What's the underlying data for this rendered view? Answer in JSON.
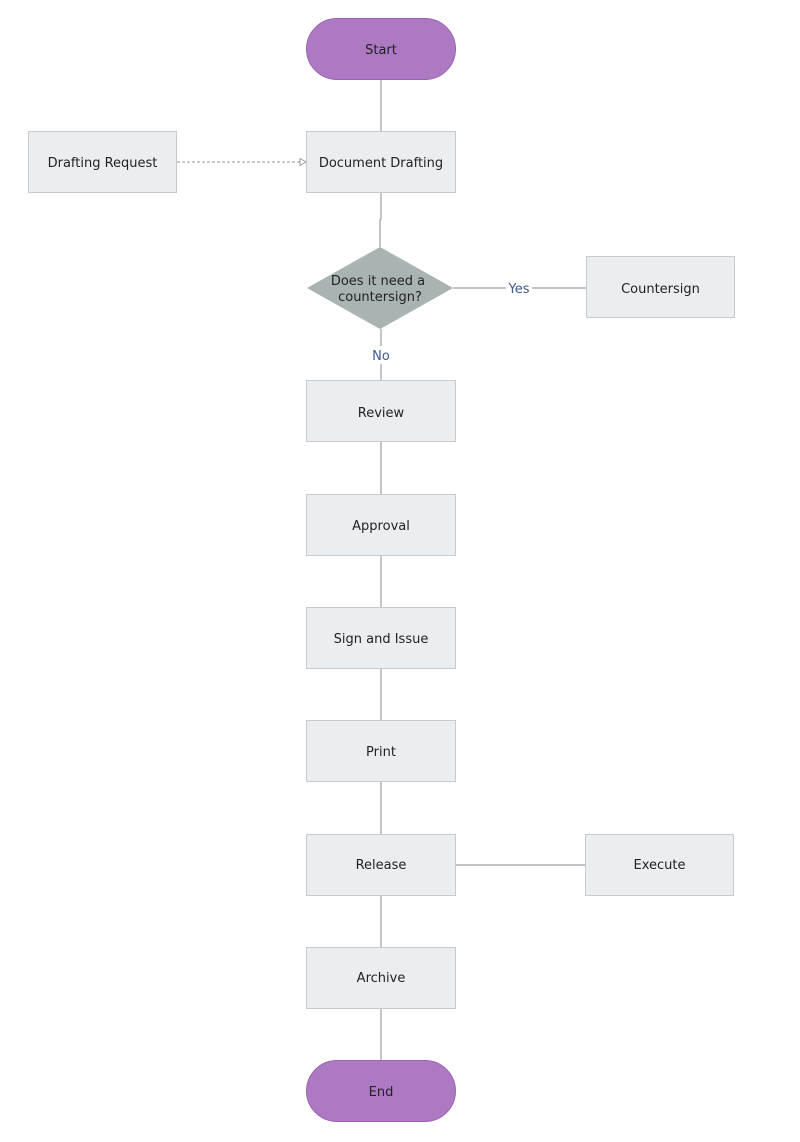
{
  "diagram": {
    "type": "flowchart",
    "colors": {
      "terminal_fill": "#ad79c2",
      "terminal_stroke": "#9b62b3",
      "process_fill": "#ebeef0",
      "process_stroke": "#c7cbcd",
      "decision_fill": "#a9b3b1",
      "connector": "#888888",
      "edge_label": "#3c5a8a",
      "text": "#222222"
    },
    "nodes": {
      "start": {
        "label": "Start",
        "shape": "terminal"
      },
      "drafting_request": {
        "label": "Drafting Request",
        "shape": "process"
      },
      "document_drafting": {
        "label": "Document Drafting",
        "shape": "process"
      },
      "decision": {
        "label_line1": "Does it need a",
        "label_line2": "countersign?",
        "shape": "decision"
      },
      "countersign": {
        "label": "Countersign",
        "shape": "process"
      },
      "review": {
        "label": "Review",
        "shape": "process"
      },
      "approval": {
        "label": "Approval",
        "shape": "process"
      },
      "sign_and_issue": {
        "label": "Sign and Issue",
        "shape": "process"
      },
      "print": {
        "label": "Print",
        "shape": "process"
      },
      "release": {
        "label": "Release",
        "shape": "process"
      },
      "execute": {
        "label": "Execute",
        "shape": "process"
      },
      "archive": {
        "label": "Archive",
        "shape": "process"
      },
      "end": {
        "label": "End",
        "shape": "terminal"
      }
    },
    "edges": [
      {
        "from": "start",
        "to": "document_drafting",
        "style": "solid"
      },
      {
        "from": "drafting_request",
        "to": "document_drafting",
        "style": "dashed",
        "arrow": "open-triangle"
      },
      {
        "from": "document_drafting",
        "to": "decision",
        "style": "solid"
      },
      {
        "from": "decision",
        "to": "countersign",
        "style": "solid",
        "label": "Yes"
      },
      {
        "from": "decision",
        "to": "review",
        "style": "solid",
        "label": "No"
      },
      {
        "from": "review",
        "to": "approval",
        "style": "solid"
      },
      {
        "from": "approval",
        "to": "sign_and_issue",
        "style": "solid"
      },
      {
        "from": "sign_and_issue",
        "to": "print",
        "style": "solid"
      },
      {
        "from": "print",
        "to": "release",
        "style": "solid"
      },
      {
        "from": "release",
        "to": "execute",
        "style": "solid"
      },
      {
        "from": "release",
        "to": "archive",
        "style": "solid"
      },
      {
        "from": "archive",
        "to": "end",
        "style": "solid"
      }
    ],
    "edge_labels": {
      "yes": "Yes",
      "no": "No"
    }
  }
}
